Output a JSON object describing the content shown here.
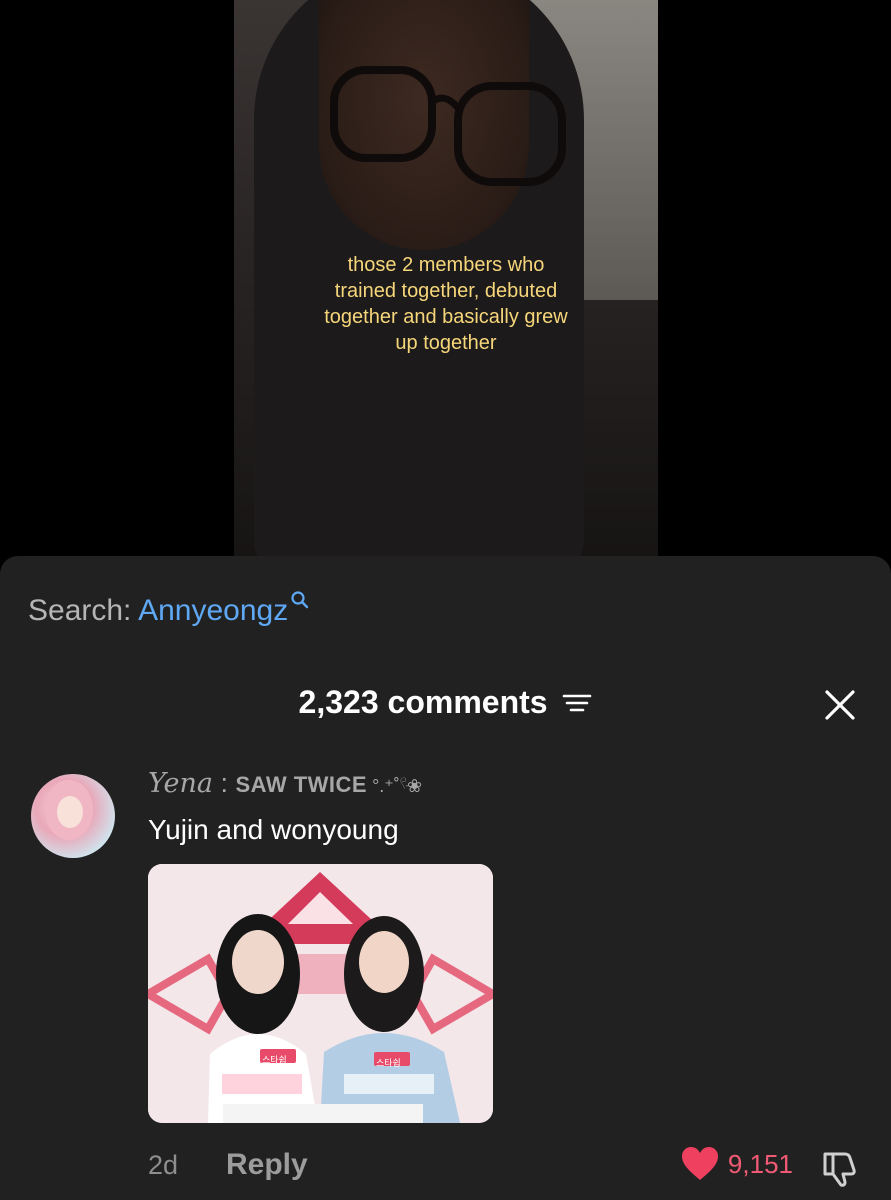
{
  "video": {
    "caption_lines": [
      "those 2 members who",
      "trained together, debuted",
      "together and basically grew",
      "up together"
    ]
  },
  "search": {
    "prefix": "Search:",
    "term": "Annyeongz",
    "icon": "search-icon"
  },
  "comments": {
    "count_label": "2,323 comments",
    "filter_icon": "filter-icon",
    "close_icon": "close-icon"
  },
  "comment": {
    "username_script": "Yena",
    "username_sep": " : ",
    "username_rest": "SAW TWICE",
    "username_deco": " °.⁺˚𓍢ּ❀",
    "text": "Yujin and wonyoung",
    "image_badges": [
      "스타쉽",
      "스타쉽"
    ],
    "time": "2d",
    "reply_label": "Reply",
    "like_count": "9,151",
    "like_color": "#f0405f"
  }
}
